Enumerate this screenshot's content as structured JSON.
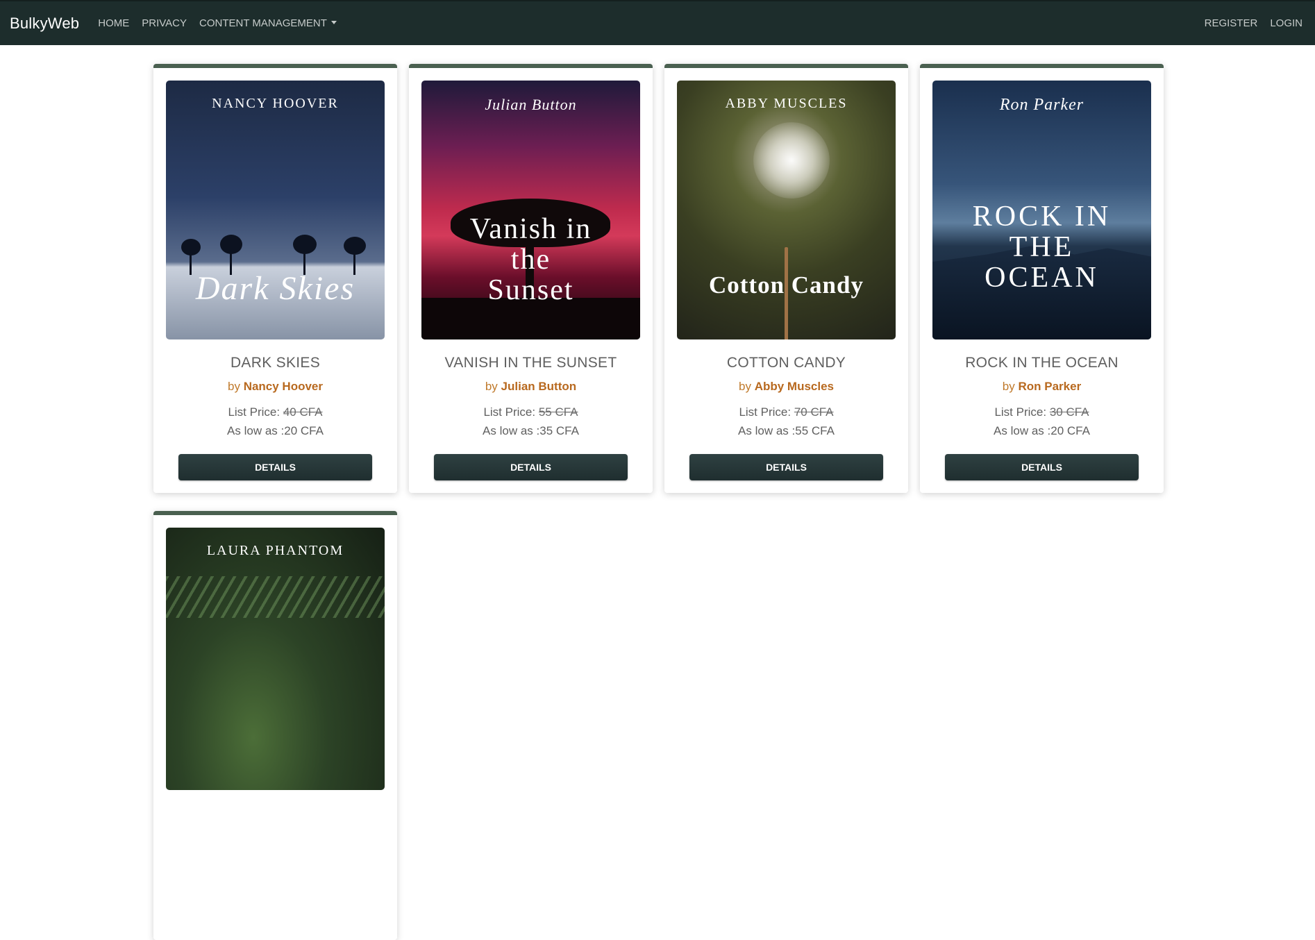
{
  "nav": {
    "brand": "BulkyWeb",
    "links": [
      "Home",
      "Privacy",
      "Content Management"
    ],
    "right_links": [
      "Register",
      "Login"
    ]
  },
  "products": [
    {
      "cover_author": "NANCY HOOVER",
      "cover_title": "Dark Skies",
      "title": "Dark Skies",
      "by_prefix": "by",
      "author": "Nancy Hoover",
      "list_price_label": "List Price:",
      "list_price": "40 CFA",
      "low_label": "As low as :20 CFA",
      "button": "Details"
    },
    {
      "cover_author": "Julian Button",
      "cover_title_line1": "Vanish in",
      "cover_title_line2": "the",
      "cover_title_line3": "Sunset",
      "title": "Vanish in the Sunset",
      "by_prefix": "by",
      "author": "Julian Button",
      "list_price_label": "List Price:",
      "list_price": "55 CFA",
      "low_label": "As low as :35 CFA",
      "button": "Details"
    },
    {
      "cover_author": "ABBY MUSCLES",
      "cover_title": "Cotton Candy",
      "title": "Cotton Candy",
      "by_prefix": "by",
      "author": "Abby Muscles",
      "list_price_label": "List Price:",
      "list_price": "70 CFA",
      "low_label": "As low as :55 CFA",
      "button": "Details"
    },
    {
      "cover_author": "Ron Parker",
      "cover_title_line1": "ROCK IN",
      "cover_title_line2": "THE",
      "cover_title_line3": "OCEAN",
      "title": "Rock in the Ocean",
      "by_prefix": "by",
      "author": "Ron Parker",
      "list_price_label": "List Price:",
      "list_price": "30 CFA",
      "low_label": "As low as :20 CFA",
      "button": "Details"
    },
    {
      "cover_author": "LAURA PHANTOM"
    }
  ]
}
